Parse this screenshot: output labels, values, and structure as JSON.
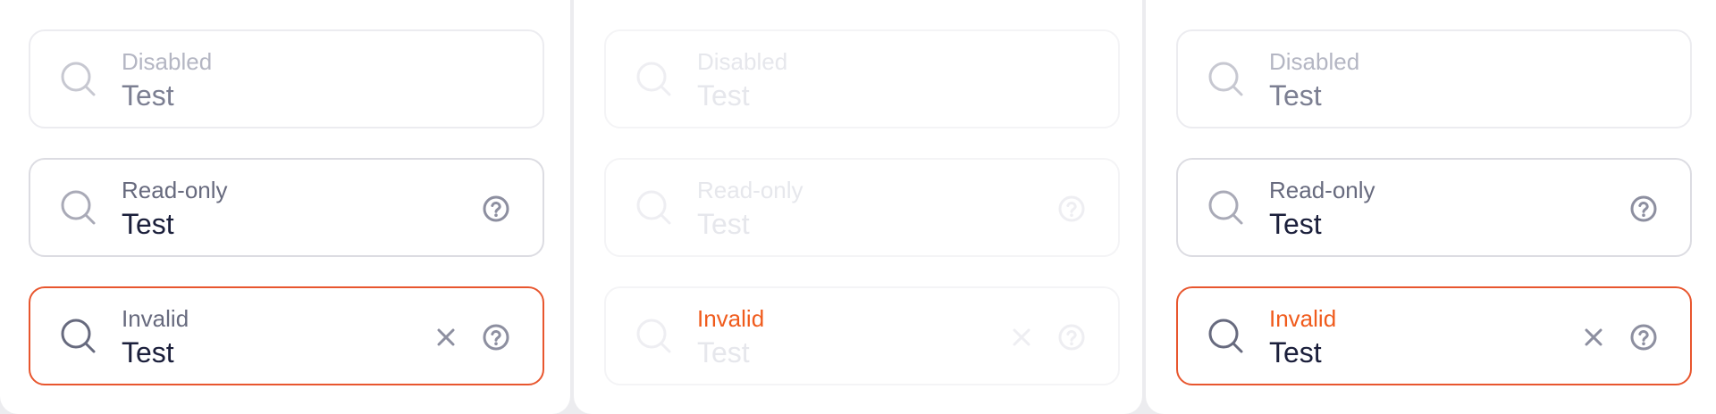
{
  "colors": {
    "border_default": "#dcdce2",
    "border_disabled": "#ececf0",
    "border_invalid": "#e8562e",
    "text_primary": "#1b1f3b",
    "text_label": "#676a7e",
    "text_invalid_label": "#f05b1c",
    "icon_default": "#a9aab7",
    "icon_active": "#676a7e"
  },
  "panels": [
    {
      "fields": [
        {
          "label": "Disabled",
          "value": "Test",
          "state": "disabled",
          "icons": [
            "search-icon"
          ]
        },
        {
          "label": "Read-only",
          "value": "Test",
          "state": "read-only",
          "icons": [
            "search-icon",
            "help-icon"
          ]
        },
        {
          "label": "Invalid",
          "value": "Test",
          "state": "invalid",
          "icons": [
            "search-icon",
            "clear-icon",
            "help-icon"
          ]
        }
      ]
    },
    {
      "fields": [
        {
          "label": "Disabled",
          "value": "Test",
          "state": "disabled",
          "icons": [
            "search-icon"
          ]
        },
        {
          "label": "Read-only",
          "value": "Test",
          "state": "read-only",
          "icons": [
            "search-icon",
            "help-icon"
          ]
        },
        {
          "label": "Invalid",
          "value": "Test",
          "state": "invalid",
          "icons": [
            "search-icon",
            "clear-icon",
            "help-icon"
          ]
        }
      ]
    },
    {
      "fields": [
        {
          "label": "Disabled",
          "value": "Test",
          "state": "disabled",
          "icons": [
            "search-icon"
          ]
        },
        {
          "label": "Read-only",
          "value": "Test",
          "state": "read-only",
          "icons": [
            "search-icon",
            "help-icon"
          ]
        },
        {
          "label": "Invalid",
          "value": "Test",
          "state": "invalid",
          "icons": [
            "search-icon",
            "clear-icon",
            "help-icon"
          ]
        }
      ]
    }
  ]
}
